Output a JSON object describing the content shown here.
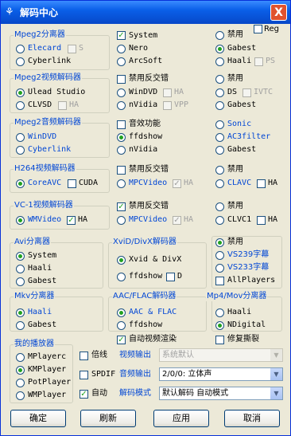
{
  "window": {
    "title": "解码中心",
    "close": "X"
  },
  "reg_label": "Reg",
  "mpeg2split": {
    "title": "Mpeg2分离器",
    "items": [
      "Elecard",
      "Cyberlink"
    ],
    "s_label": "S"
  },
  "system_col": {
    "items": [
      "System",
      "Nero",
      "ArcSoft"
    ]
  },
  "disable_col1": {
    "items": [
      "禁用",
      "Gabest",
      "Haali"
    ],
    "ps_label": "PS"
  },
  "mpeg2video": {
    "title": "Mpeg2视频解码器",
    "items": [
      "Ulead Studio",
      "CLVSD"
    ],
    "ha": "HA"
  },
  "mpeg2video_mid": {
    "deint": "禁用反交错",
    "items": [
      "WinDVD",
      "nVidia"
    ],
    "ha": "HA",
    "vpp": "VPP"
  },
  "mpeg2video_right": {
    "items": [
      "禁用",
      "DS",
      "Gabest"
    ],
    "ivtc": "IVTC"
  },
  "mpeg2audio": {
    "title": "Mpeg2音频解码器",
    "items": [
      "WinDVD",
      "Cyberlink"
    ]
  },
  "mpeg2audio_mid": {
    "effect": "音效功能",
    "items": [
      "ffdshow",
      "nVidia"
    ]
  },
  "mpeg2audio_right": {
    "items": [
      "Sonic",
      "AC3filter",
      "Gabest"
    ]
  },
  "h264": {
    "title": "H264视频解码器",
    "item": "CoreAVC",
    "cuda": "CUDA",
    "deint": "禁用反交错",
    "mpc": "MPCVideo",
    "ha": "HA",
    "disable": "禁用",
    "clavc": "CLAVC",
    "ha2": "HA"
  },
  "vc1": {
    "title": "VC-1视频解码器",
    "item": "WMVideo",
    "ha": "HA",
    "deint": "禁用反交错",
    "mpc": "MPCVideo",
    "ha2": "HA",
    "disable": "禁用",
    "clvc1": "CLVC1",
    "ha3": "HA"
  },
  "avi": {
    "title": "Avi分离器",
    "items": [
      "System",
      "Haali",
      "Gabest"
    ]
  },
  "xvid": {
    "title": "XviD/DivX解码器",
    "item1": "Xvid & DivX",
    "item2": "ffdshow",
    "d": "D"
  },
  "subs": {
    "items": [
      "禁用",
      "VS239字幕",
      "VS233字幕"
    ],
    "allplayers": "AllPlayers"
  },
  "mkv": {
    "title": "Mkv分离器",
    "items": [
      "Haali",
      "Gabest"
    ]
  },
  "aac": {
    "title": "AAC/FLAC解码器",
    "items": [
      "AAC & FLAC",
      "ffdshow"
    ]
  },
  "mp4": {
    "title": "Mp4/Mov分离器",
    "items": [
      "Haali",
      "NDigital"
    ]
  },
  "auto_render": "自动视频渲染",
  "repair": "修复撕裂",
  "players": {
    "title": "我的播放器",
    "items": [
      "MPlayerc",
      "KMPlayer",
      "PotPlayer",
      "WMPlayer"
    ]
  },
  "opts": {
    "beixian": "倍线",
    "video_out": "视频输出",
    "video_out_value": "系统默认",
    "spdif": "SPDIF",
    "audio_out": "音频输出",
    "audio_out_value": "2/0/0: 立体声",
    "auto": "自动",
    "decode_mode": "解码模式",
    "decode_mode_value": "默认解码 自动模式"
  },
  "buttons": {
    "ok": "确定",
    "refresh": "刷新",
    "apply": "应用",
    "cancel": "取消"
  }
}
